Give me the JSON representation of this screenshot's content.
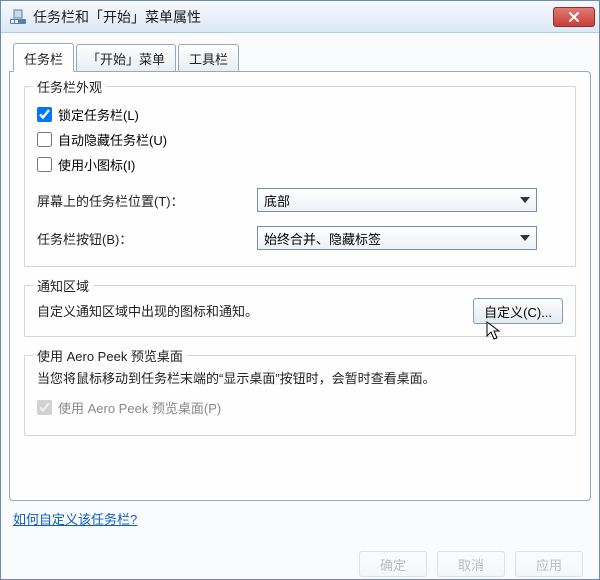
{
  "title": "任务栏和「开始」菜单属性",
  "tabs": {
    "taskbar": "任务栏",
    "start": "「开始」菜单",
    "toolbars": "工具栏"
  },
  "appearance": {
    "legend": "任务栏外观",
    "lock": "锁定任务栏(L)",
    "autohide": "自动隐藏任务栏(U)",
    "smallicons": "使用小图标(I)",
    "positionLabel": "屏幕上的任务栏位置(T)：",
    "positionValue": "底部",
    "buttonsLabel": "任务栏按钮(B)：",
    "buttonsValue": "始终合并、隐藏标签"
  },
  "notify": {
    "legend": "通知区域",
    "text": "自定义通知区域中出现的图标和通知。",
    "customizeBtn": "自定义(C)..."
  },
  "peek": {
    "legend": "使用 Aero Peek 预览桌面",
    "text": "当您将鼠标移动到任务栏末端的“显示桌面”按钮时，会暂时查看桌面。",
    "checkbox": "使用 Aero Peek 预览桌面(P)"
  },
  "link": "如何自定义该任务栏?",
  "buttons": {
    "ok": "确定",
    "cancel": "取消",
    "apply": "应用"
  }
}
